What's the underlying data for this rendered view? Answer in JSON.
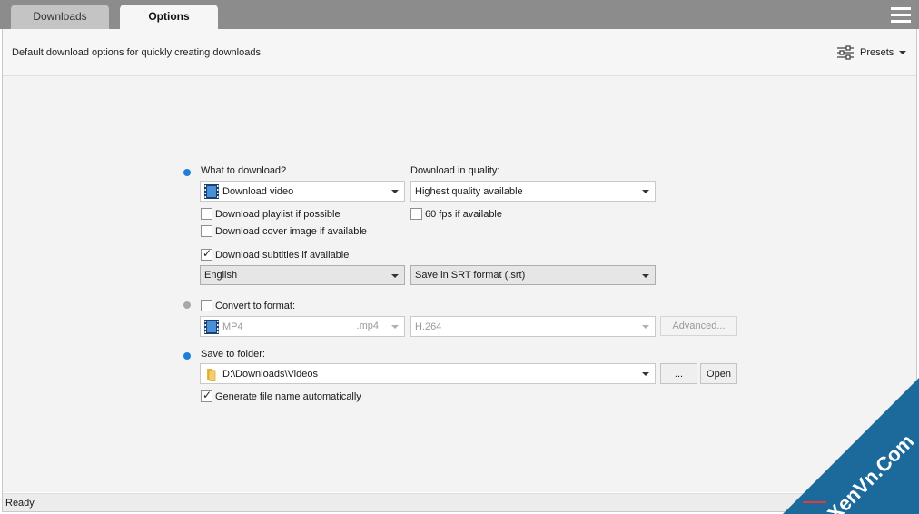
{
  "tabs": [
    {
      "label": "Downloads",
      "active": false
    },
    {
      "label": "Options",
      "active": true
    }
  ],
  "header": {
    "description": "Default download options for quickly creating downloads.",
    "presets_label": "Presets"
  },
  "what_to_download": {
    "label": "What to download?",
    "selected": "Download video",
    "playlist_label": "Download playlist if possible",
    "playlist_checked": false,
    "cover_label": "Download cover image if available",
    "cover_checked": false,
    "subtitles_label": "Download subtitles if available",
    "subtitles_checked": true,
    "subtitle_language": "English",
    "subtitle_format": "Save in SRT format (.srt)"
  },
  "quality": {
    "label": "Download in quality:",
    "selected": "Highest quality available",
    "fps_label": "60 fps if available",
    "fps_checked": false
  },
  "convert": {
    "label": "Convert to format:",
    "checked": false,
    "format": "MP4",
    "extension": ".mp4",
    "codec": "H.264",
    "advanced_label": "Advanced..."
  },
  "save": {
    "label": "Save to folder:",
    "path": "D:\\Downloads\\Videos",
    "browse_label": "...",
    "open_label": "Open",
    "auto_name_label": "Generate file name automatically",
    "auto_name_checked": true
  },
  "status": {
    "text": "Ready"
  },
  "watermark": {
    "text": "XenVn.Com"
  },
  "colors": {
    "bullet_active": "#1e7fd6",
    "bullet_inactive": "#a8a8a8",
    "tabbar": "#8c8c8c",
    "watermark": "#1b6a9b"
  },
  "icons": {
    "menu": "hamburger-icon",
    "presets": "sliders-icon",
    "video": "film-icon",
    "folder": "folder-icon"
  }
}
